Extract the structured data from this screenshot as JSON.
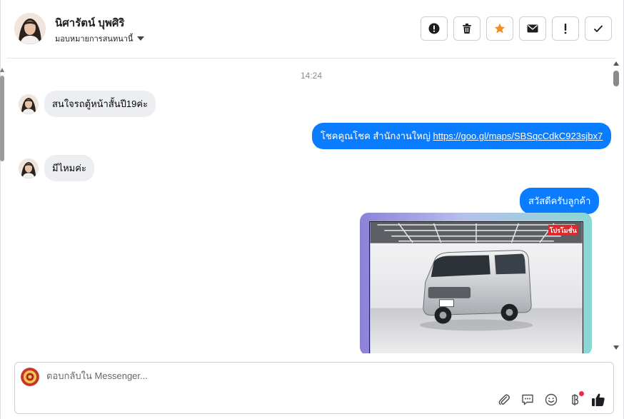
{
  "header": {
    "contact_name": "นิศารัตน์ บุพศิริ",
    "assign_label": "มอบหมายการสนทนานี้"
  },
  "actions": [
    {
      "name": "spam-button",
      "icon": "alert-circle-icon"
    },
    {
      "name": "delete-button",
      "icon": "trash-icon"
    },
    {
      "name": "star-button",
      "icon": "star-icon",
      "color": "#f28d24"
    },
    {
      "name": "mark-unread-button",
      "icon": "envelope-icon"
    },
    {
      "name": "follow-up-button",
      "icon": "exclamation-icon"
    },
    {
      "name": "done-button",
      "icon": "check-icon"
    }
  ],
  "conversation": {
    "timestamp": "14:24",
    "messages": [
      {
        "direction": "incoming",
        "text": "สนใจรถตู้หน้าสั้นปี19ค่ะ"
      },
      {
        "direction": "outgoing",
        "text": "โชคคูณโชค สำนักงานใหญ่ ",
        "link": "https://goo.gl/maps/SBSqcCdkC923sjbx7"
      },
      {
        "direction": "incoming",
        "text": "มีไหมค่ะ"
      },
      {
        "direction": "outgoing",
        "text": "สวัสดีครับลูกค้า"
      },
      {
        "direction": "outgoing",
        "type": "image",
        "badge": "โปรโมชั่น"
      }
    ]
  },
  "composer": {
    "placeholder": "ตอบกลับใน Messenger...",
    "value": ""
  },
  "colors": {
    "outgoing_bubble": "#0a7cff",
    "incoming_bubble": "#eceef1",
    "notification_dot": "#f02849"
  }
}
